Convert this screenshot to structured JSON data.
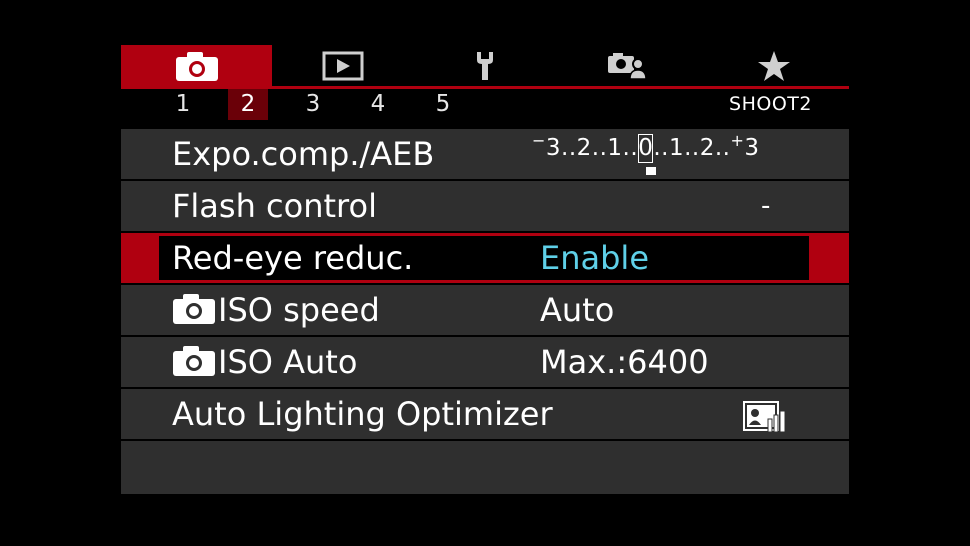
{
  "tabs": [
    {
      "name": "shooting",
      "icon": "camera-icon",
      "active": true
    },
    {
      "name": "playback",
      "icon": "playback-icon",
      "active": false
    },
    {
      "name": "setup",
      "icon": "wrench-icon",
      "active": false
    },
    {
      "name": "custom-functions",
      "icon": "custom-camera-icon",
      "active": false
    },
    {
      "name": "my-menu",
      "icon": "star-icon",
      "active": false
    }
  ],
  "pages": [
    "1",
    "2",
    "3",
    "4",
    "5"
  ],
  "active_page": "2",
  "page_title": "SHOOT2",
  "rows": [
    {
      "label": "Expo.comp./AEB",
      "value_type": "scale",
      "scale": {
        "minus": "−",
        "left": "3..2..1..",
        "zero": "0",
        "right": "..1..2..",
        "plus": "+",
        "end": "3"
      }
    },
    {
      "label": "Flash control",
      "value": "-"
    },
    {
      "label": "Red-eye reduc.",
      "value": "Enable",
      "selected": true
    },
    {
      "label": "ISO speed",
      "value": "Auto",
      "icon": "camera-icon"
    },
    {
      "label": "ISO Auto",
      "value": "Max.:6400",
      "icon": "camera-icon"
    },
    {
      "label": "Auto Lighting Optimizer",
      "value_icon": "auto-lighting-optimizer-icon"
    }
  ],
  "colors": {
    "accent": "#b00010",
    "row_bg": "#2f2f2f",
    "selected_value": "#5fd0e8"
  }
}
